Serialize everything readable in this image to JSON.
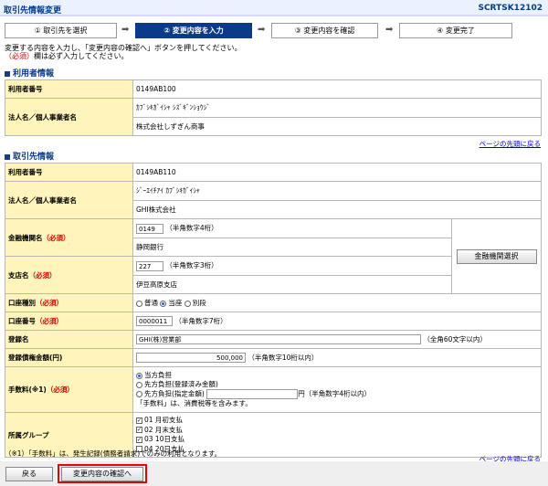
{
  "header": {
    "title": "取引先情報変更",
    "code": "SCRTSK12102"
  },
  "steps": [
    "① 取引先を選択",
    "② 変更内容を入力",
    "③ 変更内容を確認",
    "④ 変更完了"
  ],
  "instructions": {
    "line1": "変更する内容を入力し、「変更内容の確認へ」ボタンを押してください。",
    "req": "（必須）",
    "line2": "欄は必ず入力してください。"
  },
  "user_section": {
    "title": "利用者情報",
    "rows": {
      "num_label": "利用者番号",
      "num_value": "0149AB100",
      "name_label": "法人名／個人事業者名",
      "name_kana": "ｶﾌﾞｼｷｶﾞｲｼｬ ｼｽﾞｷﾞﾝｼｮｳｼﾞ",
      "name_kanji": "株式会社しずぎん商事"
    }
  },
  "page_top_link": "ページの先頭に戻る",
  "partner_section": {
    "title": "取引先情報",
    "num_label": "利用者番号",
    "num_value": "0149AB110",
    "name_label": "法人名／個人事業者名",
    "name_kana": "ｼﾞｰｴｲﾁｱｲ ｶﾌﾞｼｷｶﾞｲｼｬ",
    "name_kanji": "GHI株式会社",
    "bank_label": "金融機関名",
    "bank_code": "0149",
    "bank_hint": "（半角数字4桁）",
    "bank_name": "静岡銀行",
    "bank_select_button": "金融機関選択",
    "branch_label": "支店名",
    "branch_code": "227",
    "branch_hint": "（半角数字3桁）",
    "branch_name": "伊豆高原支店",
    "type_label": "口座種別",
    "type_options": [
      "普通",
      "当座",
      "別段"
    ],
    "acct_label": "口座番号",
    "acct_value": "0000011",
    "acct_hint": "（半角数字7桁）",
    "reg_label": "登録名",
    "reg_value": "GHI(株)営業部",
    "reg_hint": "（全角60文字以内）",
    "amount_label": "登録債権金額(円)",
    "amount_value": "500,000",
    "amount_hint": "（半角数字10桁以内）",
    "fee_label": "手数料(※1)",
    "fee_opt1": "当方負担",
    "fee_opt2": "先方負担(登録済み金額)",
    "fee_opt3": "先方負担(指定金額)",
    "fee_unit": "円（半角数字4桁以内）",
    "fee_note": "「手数料」は、消費税等を含みます。",
    "group_label": "所属グループ",
    "groups": [
      "01 月初支払",
      "02 月末支払",
      "03 10日支払",
      "04 20日支払"
    ],
    "required_mark": "（必須）"
  },
  "footnote": "（※1）「手数料」は、発生記録(債務者請求)でのみの利用となります。",
  "buttons": {
    "back": "戻る",
    "confirm": "変更内容の確認へ"
  }
}
